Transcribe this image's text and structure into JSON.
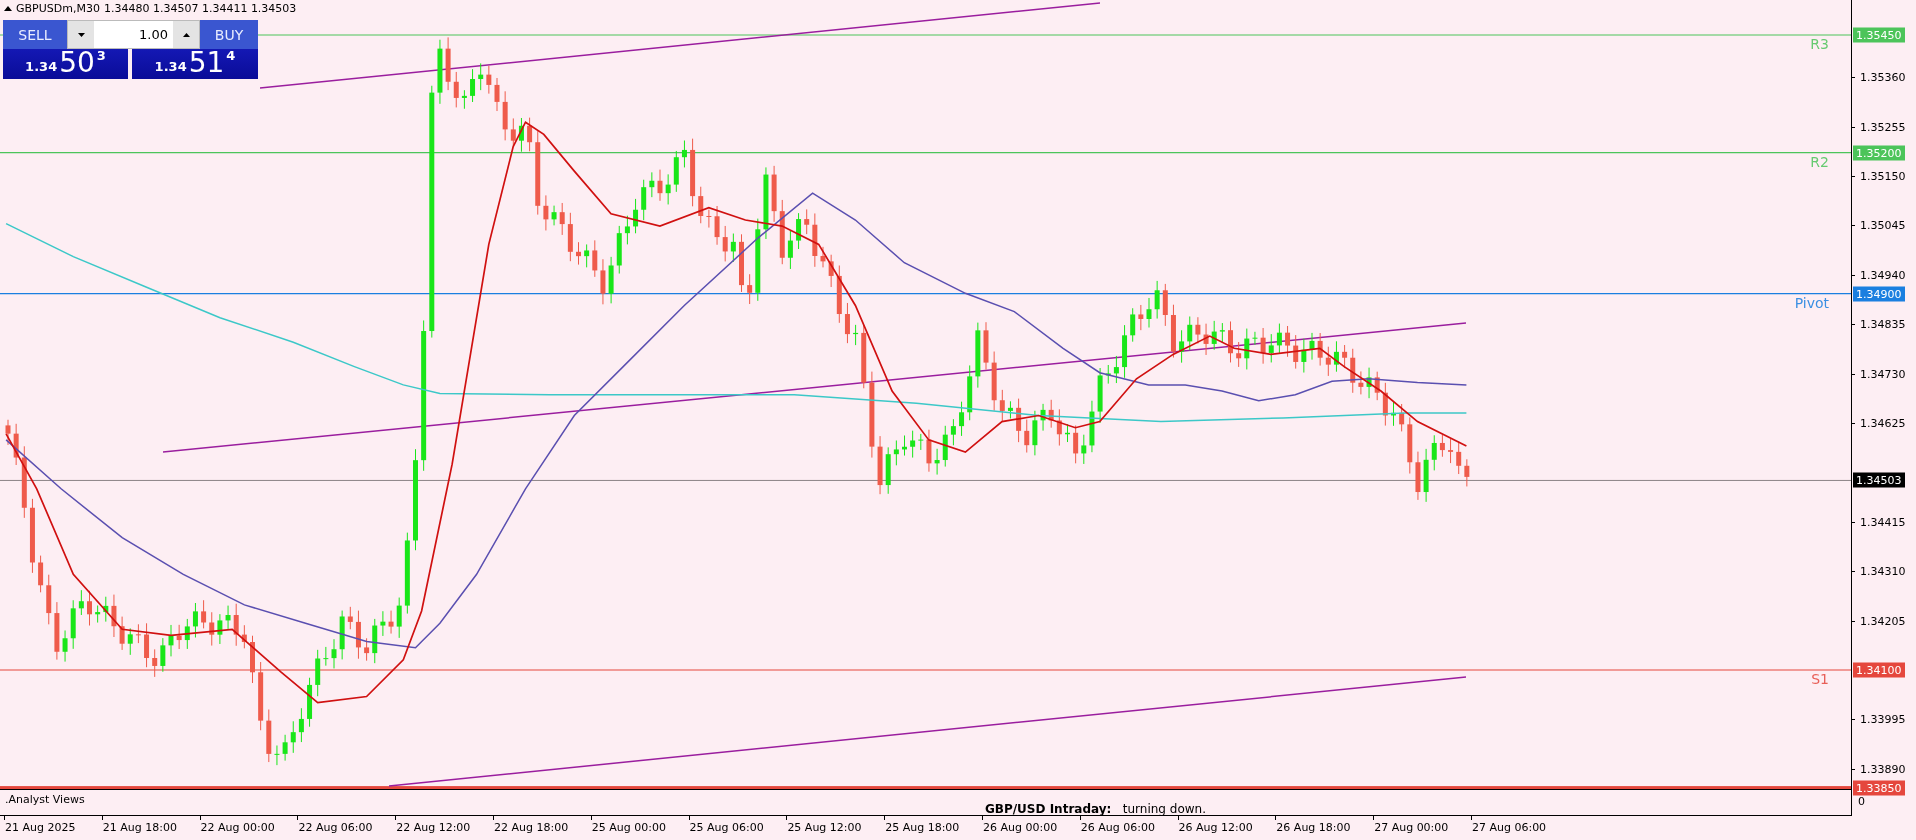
{
  "chart_header": {
    "symbol": "GBPUSDm,M30",
    "ohlc": "1.34480 1.34507 1.34411 1.34503"
  },
  "trade_panel": {
    "sell_label": "SELL",
    "buy_label": "BUY",
    "volume": "1.00",
    "sell_price": {
      "prefix": "1.34",
      "big": "50",
      "sup": "3"
    },
    "buy_price": {
      "prefix": "1.34",
      "big": "51",
      "sup": "4"
    }
  },
  "levels": [
    {
      "label": "R3",
      "price": "1.35450",
      "color": "#4cc45a",
      "kind": "line"
    },
    {
      "label": "R2",
      "price": "1.35200",
      "color": "#4cc45a",
      "kind": "line"
    },
    {
      "label": "Pivot",
      "price": "1.34900",
      "color": "#1a7fe0",
      "kind": "line"
    },
    {
      "price": "1.34503",
      "color": "#000000",
      "kind": "current"
    },
    {
      "label": "S1",
      "price": "1.34100",
      "color": "#e5473d",
      "kind": "line"
    },
    {
      "price": "1.33850",
      "color": "#e5473d",
      "kind": "thick"
    }
  ],
  "price_axis": {
    "ticks": [
      "1.35360",
      "1.35255",
      "1.35150",
      "1.35045",
      "1.34940",
      "1.34835",
      "1.34730",
      "1.34625",
      "1.34415",
      "1.34310",
      "1.34205",
      "1.33995",
      "1.33890"
    ]
  },
  "indicator_window": {
    "name": ".Analyst Views",
    "comment": "**GBP/USD Intraday:**   turning down.",
    "axis_value": "0"
  },
  "time_axis": [
    "21 Aug 2025",
    "21 Aug 18:00",
    "22 Aug 00:00",
    "22 Aug 06:00",
    "22 Aug 12:00",
    "22 Aug 18:00",
    "25 Aug 00:00",
    "25 Aug 06:00",
    "25 Aug 12:00",
    "25 Aug 18:00",
    "26 Aug 00:00",
    "26 Aug 06:00",
    "26 Aug 12:00",
    "26 Aug 18:00",
    "27 Aug 00:00",
    "27 Aug 06:00"
  ]
}
